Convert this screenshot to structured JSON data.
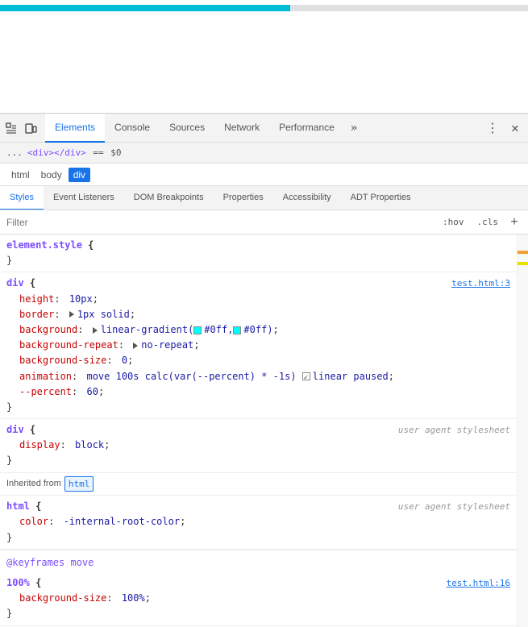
{
  "preview": {
    "progress_width": "55%",
    "progress_color": "#00bcd4"
  },
  "devtools": {
    "tabs": [
      {
        "label": "Elements",
        "active": true
      },
      {
        "label": "Console",
        "active": false
      },
      {
        "label": "Sources",
        "active": false
      },
      {
        "label": "Network",
        "active": false
      },
      {
        "label": "Performance",
        "active": false
      }
    ],
    "tab_overflow": "»",
    "action_more": "⋮",
    "action_close": "✕",
    "breadcrumb": {
      "dots": "...",
      "tag": "<div></div>",
      "arrow": "==",
      "value": "$0"
    },
    "node_path": [
      "html",
      "body",
      "div"
    ],
    "selected_node": "div",
    "sub_tabs": [
      {
        "label": "Styles",
        "active": true
      },
      {
        "label": "Event Listeners",
        "active": false
      },
      {
        "label": "DOM Breakpoints",
        "active": false
      },
      {
        "label": "Properties",
        "active": false
      },
      {
        "label": "Accessibility",
        "active": false
      },
      {
        "label": "ADT Properties",
        "active": false
      }
    ],
    "filter": {
      "placeholder": "Filter",
      "hov_btn": ":hov",
      "cls_btn": ".cls",
      "plus_btn": "+"
    },
    "css_rules": [
      {
        "selector": "element.style",
        "file": null,
        "properties": [],
        "open_brace": "{",
        "close_brace": "}"
      },
      {
        "selector": "div",
        "file": "test.html:3",
        "properties": [
          {
            "name": "height",
            "value": "10px",
            "has_swatch": false,
            "strikethrough": false
          },
          {
            "name": "border",
            "value": "▶ 1px solid",
            "has_swatch": false,
            "strikethrough": false,
            "has_arrow": true
          },
          {
            "name": "background",
            "value": "▶ linear-gradient(",
            "swatch1": "#0ff",
            "swatch2": "#0ff",
            "value2": "#0ff,",
            "value3": "#0ff);",
            "has_swatch": true,
            "strikethrough": false
          },
          {
            "name": "background-repeat",
            "value": "▶ no-repeat",
            "has_arrow": true,
            "strikethrough": false
          },
          {
            "name": "background-size",
            "value": "0",
            "strikethrough": false
          },
          {
            "name": "animation",
            "value": "move 100s calc(var(--percent) * -1s)",
            "checkbox": true,
            "extra": "linear paused",
            "strikethrough": false
          },
          {
            "name": "--percent",
            "value": "60",
            "strikethrough": false
          }
        ],
        "open_brace": "{",
        "close_brace": "}"
      },
      {
        "selector": "div",
        "file": null,
        "user_agent": "user agent stylesheet",
        "properties": [
          {
            "name": "display",
            "value": "block",
            "strikethrough": false
          }
        ],
        "open_brace": "{",
        "close_brace": "}"
      }
    ],
    "inherited": {
      "label": "Inherited from",
      "tag": "html",
      "rules": [
        {
          "selector": "html",
          "file": null,
          "user_agent": "user agent stylesheet",
          "properties": [
            {
              "name": "color",
              "value": "-internal-root-color",
              "strikethrough": false
            }
          ],
          "open_brace": "{",
          "close_brace": "}"
        }
      ]
    },
    "keyframes": {
      "label": "@keyframes move",
      "stops": [
        {
          "selector": "100%",
          "file": "test.html:16",
          "properties": [
            {
              "name": "background-size",
              "value": "100%",
              "strikethrough": false
            }
          ],
          "open_brace": "{",
          "close_brace": "}"
        }
      ]
    }
  }
}
